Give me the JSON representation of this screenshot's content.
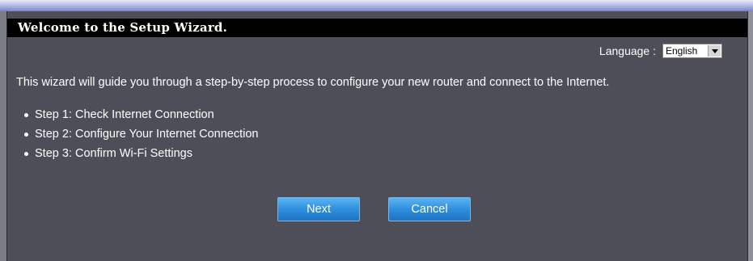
{
  "wizard": {
    "title": "Welcome to the Setup Wizard.",
    "language_label": "Language :",
    "language_selected": "English",
    "intro": "This wizard will guide you through a step-by-step process to configure your new router and connect to the Internet.",
    "steps": [
      "Step 1: Check Internet Connection",
      "Step 2: Configure Your Internet Connection",
      "Step 3: Confirm Wi-Fi Settings"
    ],
    "next_label": "Next",
    "cancel_label": "Cancel"
  },
  "colors": {
    "panel_background": "#4d4e57",
    "title_background": "#000000",
    "button_blue": "#2f8fdc"
  },
  "icons": {
    "select_arrow": "chevron-down-icon",
    "step_bullet": "bullet-icon"
  }
}
